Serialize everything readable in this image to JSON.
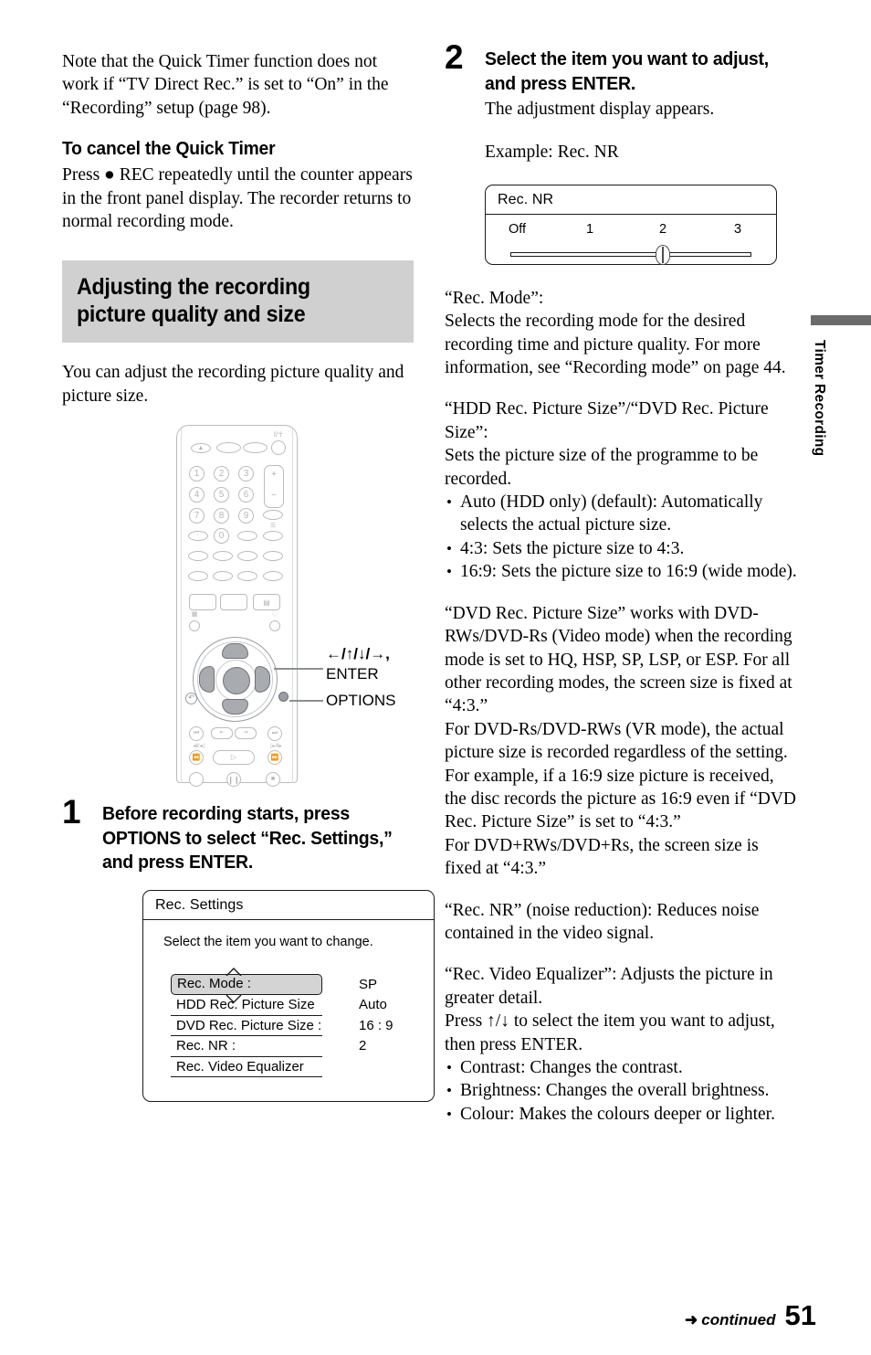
{
  "left_column": {
    "intro_note": "Note that the Quick Timer function does not work if “TV Direct Rec.” is set to “On” in the “Recording” setup (page 98).",
    "cancel_heading": "To cancel the Quick Timer",
    "cancel_body": "Press ● REC repeatedly until the counter appears in the front panel display. The recorder returns to normal recording mode.",
    "section_title": "Adjusting the recording picture quality and size",
    "section_intro": "You can adjust the recording picture quality and picture size.",
    "step1": {
      "number": "1",
      "title": "Before recording starts, press OPTIONS to select “Rec. Settings,” and press ENTER."
    },
    "callouts": {
      "dpad": "←/↑/↓/→,",
      "enter": "ENTER",
      "options": "OPTIONS"
    }
  },
  "rec_settings_dialog": {
    "title": "Rec. Settings",
    "intro": "Select the item you want to change.",
    "rows": [
      {
        "label": "Rec. Mode :",
        "value": "SP",
        "selected": true
      },
      {
        "label": "HDD Rec. Picture Size :",
        "value": "Auto",
        "selected": false
      },
      {
        "label": "DVD Rec. Picture Size :",
        "value": "16 : 9",
        "selected": false
      },
      {
        "label": "Rec. NR :",
        "value": "2",
        "selected": false
      },
      {
        "label": "Rec. Video Equalizer",
        "value": "",
        "selected": false
      }
    ]
  },
  "right_column": {
    "step2": {
      "number": "2",
      "title": "Select the item you want to adjust, and press ENTER.",
      "body": "The adjustment display appears.",
      "example": "Example: Rec. NR"
    },
    "paragraphs": [
      "“Rec. Mode”:",
      "Selects the recording mode for the desired recording time and picture quality. For more information, see “Recording mode” on page 44.",
      "“HDD Rec. Picture Size”/“DVD Rec. Picture Size”:",
      "Sets the picture size of the programme to be recorded."
    ],
    "picture_size_bullets": [
      "Auto (HDD only) (default): Automatically selects the actual picture size.",
      "4:3: Sets the picture size to 4:3.",
      "16:9: Sets the picture size to 16:9 (wide mode)."
    ],
    "dvd_paragraph_1": "“DVD Rec. Picture Size” works with DVD-RWs/DVD-Rs (Video mode) when the recording mode is set to HQ, HSP, SP, LSP, or ESP. For all other recording modes, the screen size is fixed at “4:3.”",
    "dvd_paragraph_2": "For DVD-Rs/DVD-RWs (VR mode), the actual picture size is recorded regardless of the setting. For example, if a 16:9 size picture is received, the disc records the picture as 16:9 even if “DVD Rec. Picture Size” is set to “4:3.”",
    "dvd_paragraph_3": "For DVD+RWs/DVD+Rs, the screen size is fixed at “4:3.”",
    "rec_nr_paragraph": "“Rec. NR” (noise reduction): Reduces noise contained in the video signal.",
    "equalizer_paragraph_1": "“Rec. Video Equalizer”: Adjusts the picture in greater detail.",
    "equalizer_paragraph_2": "Press ↑/↓ to select the item you want to adjust, then press ENTER.",
    "equalizer_bullets": [
      "Contrast: Changes the contrast.",
      "Brightness: Changes the overall brightness.",
      "Colour: Makes the colours deeper or lighter."
    ]
  },
  "rec_nr_dialog": {
    "title": "Rec. NR",
    "ticks": [
      "Off",
      "1",
      "2",
      "3"
    ],
    "value": "2"
  },
  "side_tab": {
    "label": "Timer Recording",
    "color": "#6b6b6b"
  },
  "footer": {
    "arrow": "➜",
    "continued": "continued",
    "page_number": "51"
  }
}
